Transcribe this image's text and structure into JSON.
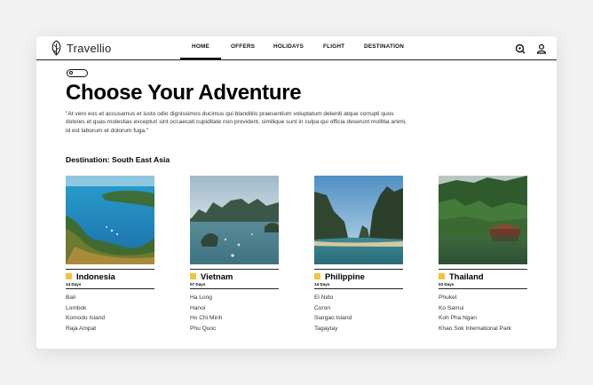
{
  "brand": {
    "name": "Travellio",
    "icon": "leaf-logo-icon"
  },
  "nav": {
    "items": [
      "HOME",
      "OFFERS",
      "HOLIDAYS",
      "FLIGHT",
      "DESTINATION"
    ],
    "active": "HOME",
    "icons": [
      "search-icon",
      "user-icon"
    ]
  },
  "hero": {
    "title": "Choose Your Adventure",
    "description": "\"At vero eos et accusamus et iusto odio dignissimos ducimus qui blanditiis praesentium voluptatum deleniti atque corrupti quos dolores et quas molestias excepturi sint occaecati cupiditate non provident, similique sunt in culpa qui officia deserunt mollitia animi, id est laborum et dolorum fuga.\""
  },
  "section": {
    "label": "Destination: South East Asia"
  },
  "cards": [
    {
      "name": "Indonesia",
      "days": "14 Days",
      "places": [
        "Bali",
        "Lombok",
        "Komodo Island",
        "Raja Ampat"
      ]
    },
    {
      "name": "Vietnam",
      "days": "07 Days",
      "places": [
        "Ha Long",
        "Hanoi",
        "Ho Chi Minh",
        "Phu Quoc"
      ]
    },
    {
      "name": "Philippine",
      "days": "14 Days",
      "places": [
        "El Nido",
        "Coron",
        "Siargao Island",
        "Tagaytay"
      ]
    },
    {
      "name": "Thailand",
      "days": "03 Days",
      "places": [
        "Phuket",
        "Ko Samui",
        "Koh Pha Ngan",
        "Khao Sok International Park"
      ]
    }
  ],
  "colors": {
    "accent": "#f5c33b",
    "text": "#111111",
    "background": "#f2f2f2"
  }
}
